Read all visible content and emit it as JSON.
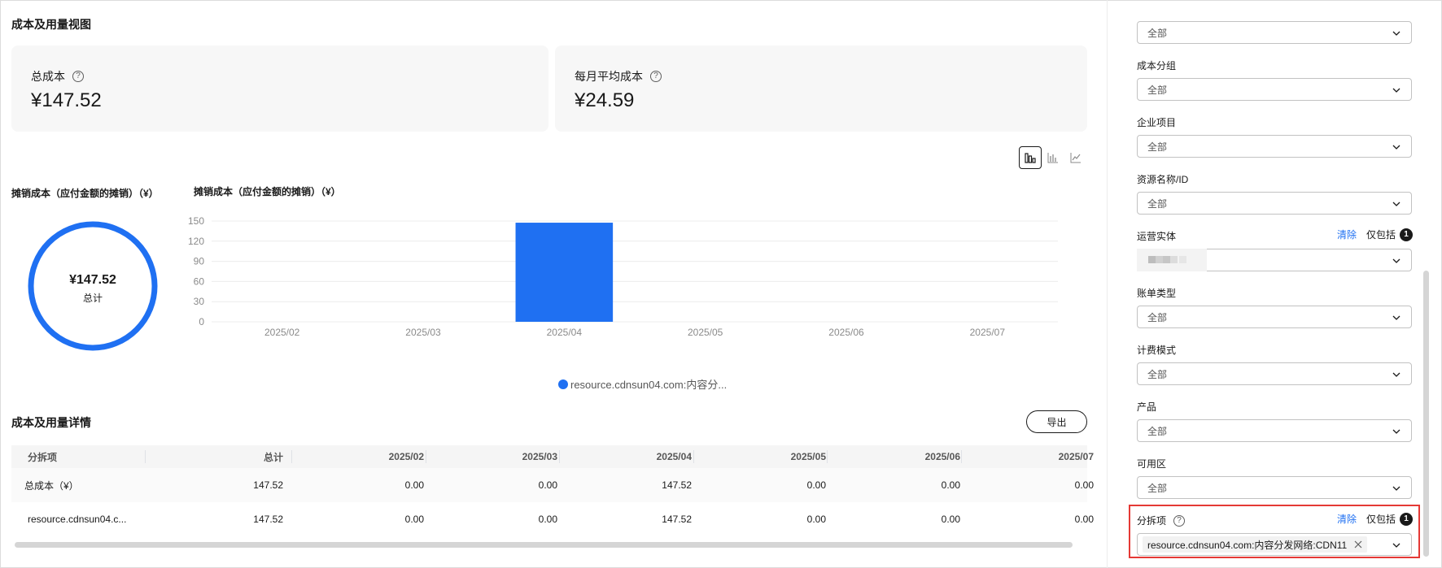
{
  "overview": {
    "title": "成本及用量视图",
    "cards": [
      {
        "label": "总成本",
        "value": "¥147.52"
      },
      {
        "label": "每月平均成本",
        "value": "¥24.59"
      }
    ]
  },
  "view_toggle": {
    "active": "bar"
  },
  "donut": {
    "title": "摊销成本（应付金额的摊销）（¥）",
    "value": "¥147.52",
    "label": "总计",
    "color": "#1f70f2"
  },
  "bar_chart_title": "摊销成本（应付金额的摊销）（¥）",
  "chart_data": {
    "type": "bar",
    "categories": [
      "2025/02",
      "2025/03",
      "2025/04",
      "2025/05",
      "2025/06",
      "2025/07"
    ],
    "series": [
      {
        "name": "resource.cdnsun04.com:内容分...",
        "values": [
          0,
          0,
          147.52,
          0,
          0,
          0
        ],
        "color": "#1f70f2"
      }
    ],
    "yticks": [
      "150",
      "120",
      "90",
      "60",
      "30",
      "0"
    ],
    "ylim": [
      0,
      150
    ],
    "grid": true,
    "legend_position": "bottom"
  },
  "details": {
    "title": "成本及用量详情",
    "export_label": "导出",
    "columns": [
      "分拆项",
      "总计",
      "2025/02",
      "2025/03",
      "2025/04",
      "2025/05",
      "2025/06",
      "2025/07"
    ],
    "rows": [
      [
        "总成本（¥）",
        "147.52",
        "0.00",
        "0.00",
        "147.52",
        "0.00",
        "0.00",
        "0.00"
      ],
      [
        "resource.cdnsun04.c...",
        "147.52",
        "0.00",
        "0.00",
        "147.52",
        "0.00",
        "0.00",
        "0.00"
      ]
    ]
  },
  "filters": {
    "top_select": "全部",
    "fields": [
      {
        "label": "成本分组",
        "value": "全部"
      },
      {
        "label": "企业项目",
        "value": "全部"
      },
      {
        "label": "资源名称/ID",
        "value": "全部"
      },
      {
        "label": "运营实体",
        "value": "",
        "clear": "清除",
        "only_include": "仅包括",
        "count": "1"
      },
      {
        "label": "账单类型",
        "value": "全部"
      },
      {
        "label": "计费模式",
        "value": "全部"
      },
      {
        "label": "产品",
        "value": "全部"
      },
      {
        "label": "可用区",
        "value": "全部"
      },
      {
        "label": "分拆项",
        "tag": "resource.cdnsun04.com:内容分发网络:CDN11",
        "clear": "清除",
        "only_include": "仅包括",
        "count": "1"
      }
    ]
  }
}
